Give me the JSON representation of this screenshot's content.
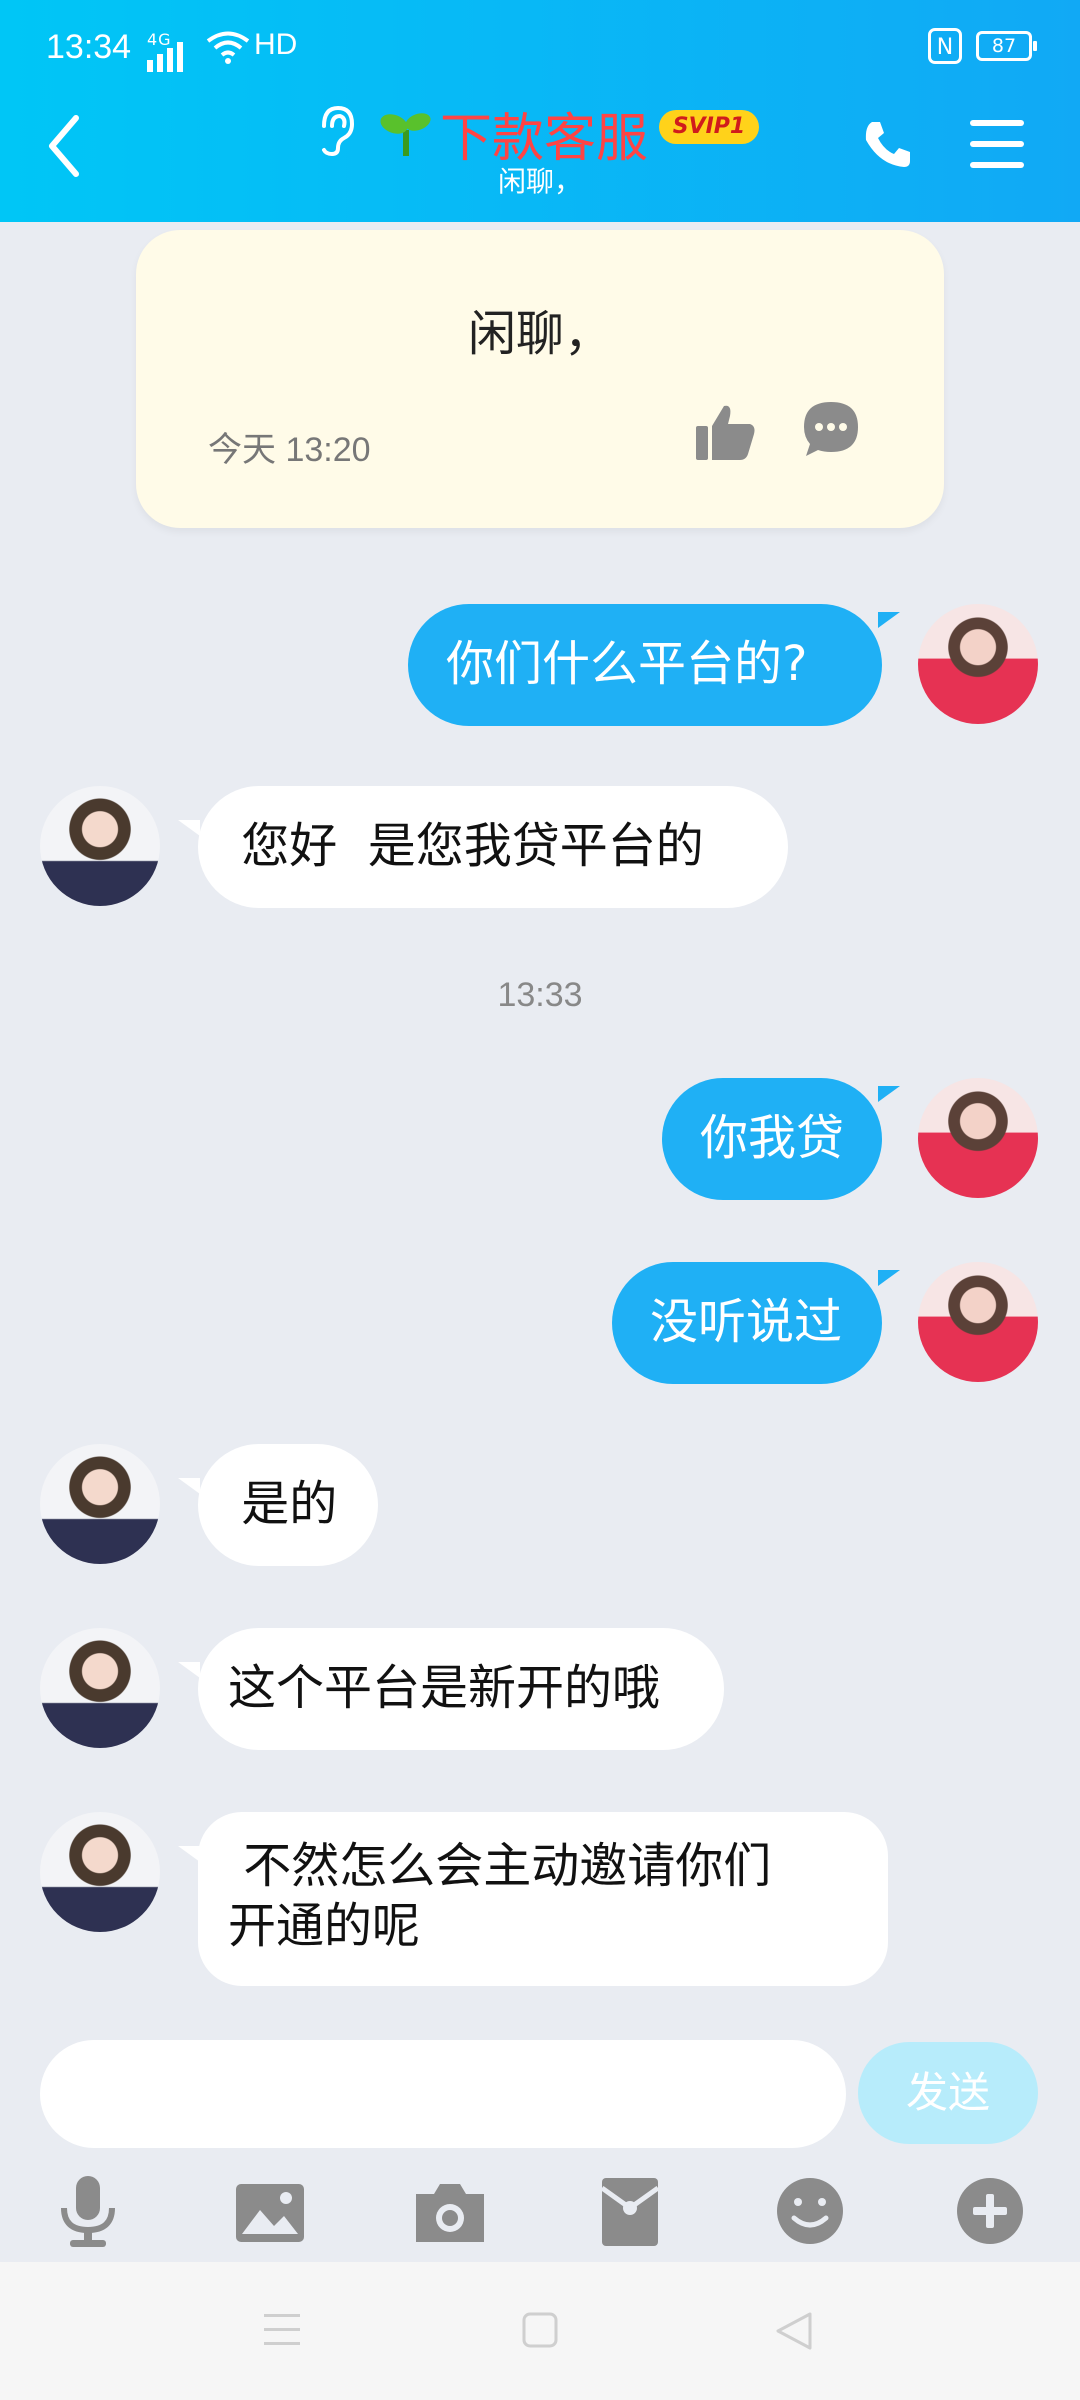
{
  "status_bar": {
    "time": "13:34",
    "network": "4G",
    "hd": "HD",
    "nfc": "N",
    "battery": "87"
  },
  "header": {
    "title": "下款客服",
    "badge": "SVIP1",
    "subtitle": "闲聊，"
  },
  "system_card": {
    "text": "闲聊，",
    "time": "今天 13:20"
  },
  "messages": [
    {
      "side": "out",
      "text": "你们什么平台的?"
    },
    {
      "side": "in",
      "text": " 您好  是您我贷平台的"
    },
    {
      "side": "out",
      "text": "你我贷"
    },
    {
      "side": "out",
      "text": "没听说过"
    },
    {
      "side": "in",
      "text": " 是的"
    },
    {
      "side": "in",
      "text": "这个平台是新开的哦"
    },
    {
      "side": "in",
      "text": " 不然怎么会主动邀请你们开通的呢"
    }
  ],
  "timestamp": "13:33",
  "composer": {
    "value": "",
    "send_label": "发送"
  },
  "toolbar": [
    "mic-icon",
    "image-icon",
    "camera-icon",
    "red-packet-icon",
    "emoji-icon",
    "plus-icon"
  ],
  "colors": {
    "header_gradient_start": "#00c6f6",
    "header_gradient_end": "#11a9f5",
    "out_bubble": "#1fb0f5",
    "title_red": "#ff4444",
    "badge_yellow": "#ffd21a"
  }
}
